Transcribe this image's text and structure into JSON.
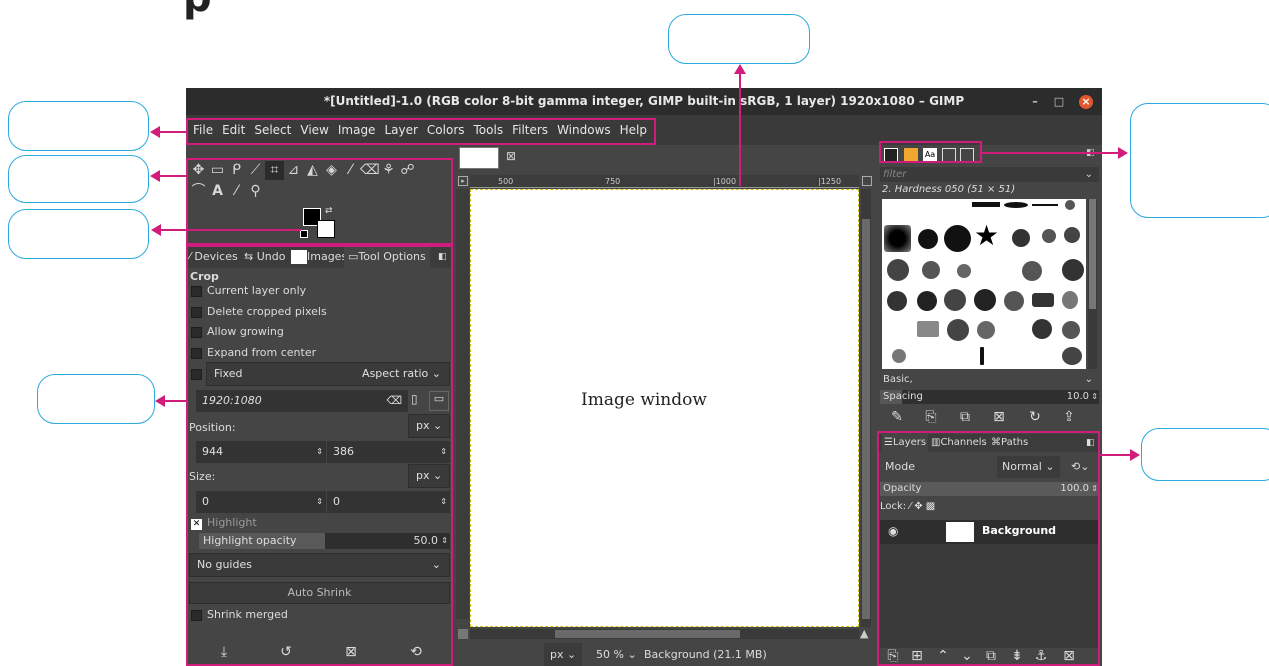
{
  "window": {
    "title": "*[Untitled]-1.0 (RGB color 8-bit gamma integer, GIMP built-in sRGB, 1 layer) 1920x1080 – GIMP",
    "minimize": "–",
    "maximize": "□",
    "close": "×"
  },
  "menu": [
    "File",
    "Edit",
    "Select",
    "View",
    "Image",
    "Layer",
    "Colors",
    "Tools",
    "Filters",
    "Windows",
    "Help"
  ],
  "dock_tabs": {
    "devices": "Devices",
    "undo": "Undo",
    "images": "Images",
    "tool_options": "Tool Options"
  },
  "tool_options": {
    "tool_name": "Crop",
    "current_layer_only": "Current layer only",
    "delete_cropped": "Delete cropped pixels",
    "allow_growing": "Allow growing",
    "expand_center": "Expand from center",
    "fixed": "Fixed",
    "aspect": "Aspect ratio",
    "ratio_value": "1920:1080",
    "position_label": "Position:",
    "unit": "px",
    "pos_x": "944",
    "pos_y": "386",
    "size_label": "Size:",
    "size_x": "0",
    "size_y": "0",
    "highlight": "Highlight",
    "highlight_opacity": "Highlight opacity",
    "highlight_opacity_value": "50.0",
    "guides": "No guides",
    "auto_shrink": "Auto Shrink",
    "shrink_merged": "Shrink merged"
  },
  "ruler": {
    "r500": "500",
    "r750": "750",
    "r1000": "|1000",
    "r1250": "|1250"
  },
  "canvas": {
    "label": "Image window"
  },
  "status": {
    "unit": "px",
    "zoom": "50 %",
    "layer_info": "Background (21.1 MB)"
  },
  "brushes": {
    "filter_placeholder": "filter",
    "brush_name": "2. Hardness 050 (51 × 51)",
    "tag": "Basic,",
    "spacing_label": "Spacing",
    "spacing_value": "10.0"
  },
  "layers_tabs": {
    "layers": "Layers",
    "channels": "Channels",
    "paths": "Paths"
  },
  "layers": {
    "mode_label": "Mode",
    "mode_value": "Normal",
    "opacity_label": "Opacity",
    "opacity_value": "100.0",
    "lock_label": "Lock:",
    "layer_name": "Background"
  }
}
